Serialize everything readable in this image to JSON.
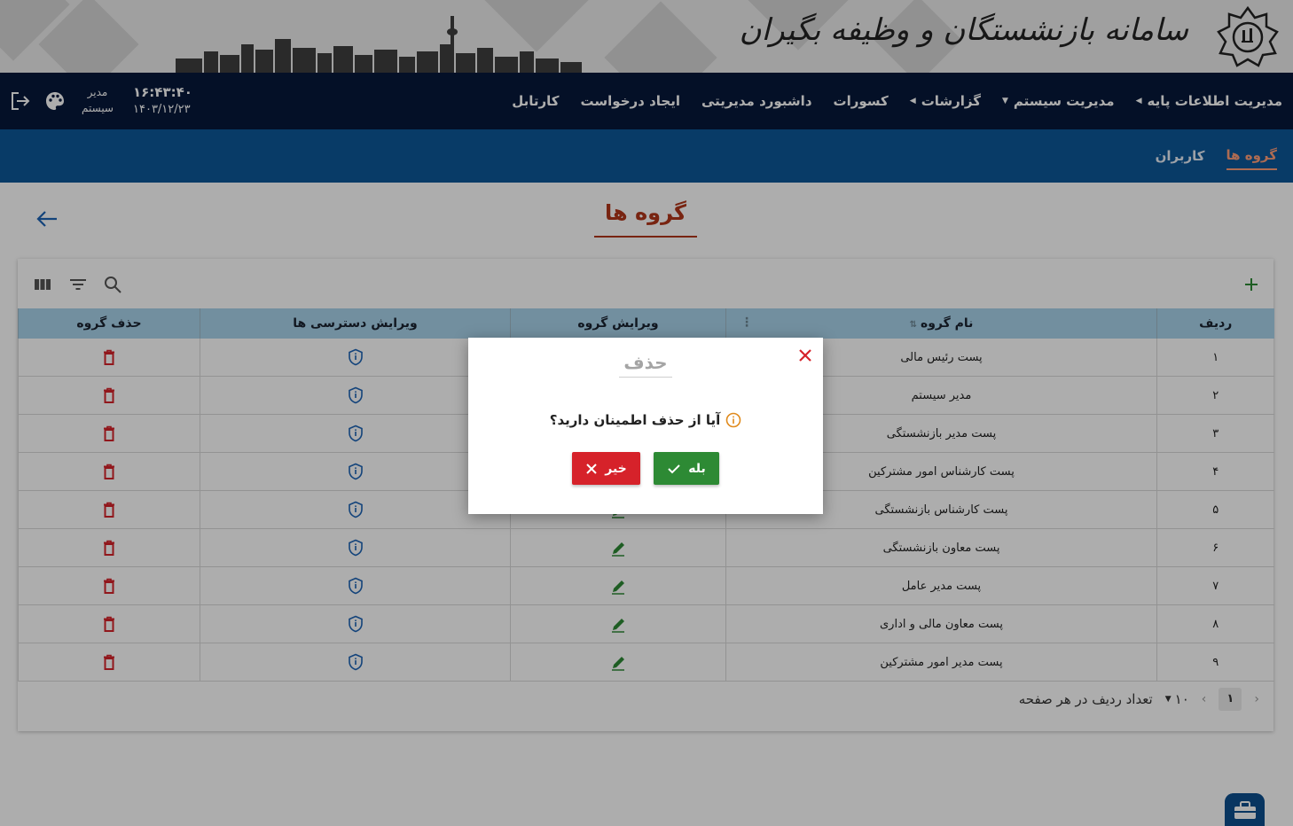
{
  "banner": {
    "title": "سامانه بازنشستگان و وظیفه بگیران"
  },
  "nav": {
    "items": [
      {
        "label": "کارتابل",
        "caret": ""
      },
      {
        "label": "ایجاد درخواست",
        "caret": ""
      },
      {
        "label": "داشبورد مدیریتی",
        "caret": ""
      },
      {
        "label": "کسورات",
        "caret": ""
      },
      {
        "label": "گزارشات",
        "caret": "◀"
      },
      {
        "label": "مدیریت سیستم",
        "caret": "▼"
      },
      {
        "label": "مدیریت اطلاعات پایه",
        "caret": "◀"
      }
    ],
    "user": {
      "line1": "مدیر",
      "line2": "سیستم"
    },
    "clock": {
      "time": "۱۶:۴۳:۴۰",
      "date": "۱۴۰۳/۱۲/۲۳"
    }
  },
  "subnav": {
    "tabs": [
      {
        "label": "کاربران",
        "active": false
      },
      {
        "label": "گروه ها",
        "active": true
      }
    ]
  },
  "page": {
    "title": "گروه ها"
  },
  "table": {
    "headers": {
      "row": "ردیف",
      "name": "نام گروه",
      "edit": "ویرایش گروه",
      "access": "ویرایش دسترسی ها",
      "delete": "حذف گروه"
    },
    "rows": [
      {
        "row": "۱",
        "name": "پست رئیس مالی"
      },
      {
        "row": "۲",
        "name": "مدیر سیستم"
      },
      {
        "row": "۳",
        "name": "پست مدیر بازنشستگی"
      },
      {
        "row": "۴",
        "name": "پست کارشناس امور مشترکین"
      },
      {
        "row": "۵",
        "name": "پست کارشناس بازنشستگی"
      },
      {
        "row": "۶",
        "name": "پست معاون بازنشستگی"
      },
      {
        "row": "۷",
        "name": "پست مدیر عامل"
      },
      {
        "row": "۸",
        "name": "پست معاون مالی و اداری"
      },
      {
        "row": "۹",
        "name": "پست مدیر امور مشترکین"
      }
    ]
  },
  "pager": {
    "rows_per_page_label": "تعداد ردیف در هر صفحه",
    "rows_per_page": "۱۰",
    "current_page": "۱"
  },
  "dialog": {
    "title": "حذف",
    "message": "آیا از حذف اطمینان دارید؟",
    "yes_label": "بله",
    "no_label": "خیر"
  },
  "colors": {
    "nav_bg": "#07193a",
    "subnav_bg": "#0d5799",
    "accent": "#b2361a",
    "header_bg": "#a8d3ea",
    "delete": "#d6222a",
    "confirm": "#2d8a34"
  }
}
